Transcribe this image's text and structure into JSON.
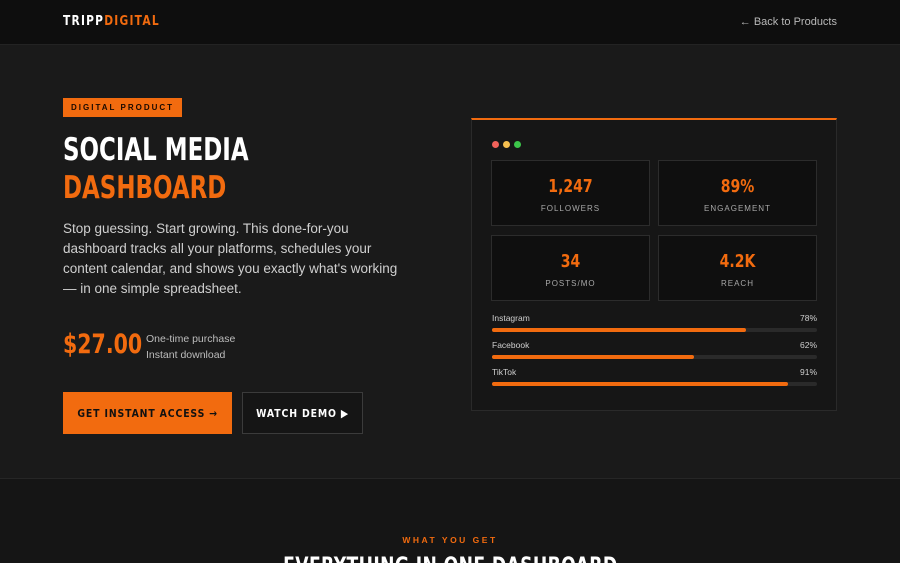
{
  "header": {
    "logo_part1": "TRIPP",
    "logo_part2": "DIGITAL",
    "back_link": "← Back to Products"
  },
  "hero": {
    "badge": "DIGITAL PRODUCT",
    "title_line1": "SOCIAL MEDIA",
    "title_line2": "DASHBOARD",
    "description": "Stop guessing. Start growing. This done-for-you dashboard tracks all your platforms, schedules your content calendar, and shows you exactly what's working — in one simple spreadsheet.",
    "price": "$27.00",
    "price_note1": "One-time purchase",
    "price_note2": "Instant download",
    "primary_button": "GET INSTANT ACCESS →",
    "secondary_button": "WATCH DEMO ▶"
  },
  "preview": {
    "window_dots": [
      "#f0625a",
      "#f5bf4f",
      "#3cc54a"
    ],
    "stats": [
      {
        "value": "1,247",
        "label": "FOLLOWERS"
      },
      {
        "value": "89%",
        "label": "ENGAGEMENT"
      },
      {
        "value": "34",
        "label": "POSTS/MO"
      },
      {
        "value": "4.2K",
        "label": "REACH"
      }
    ],
    "bars": [
      {
        "name": "Instagram",
        "percent_label": "78%",
        "fraction": 0.78
      },
      {
        "name": "Facebook",
        "percent_label": "62%",
        "fraction": 0.62
      },
      {
        "name": "TikTok",
        "percent_label": "91%",
        "fraction": 0.91
      }
    ]
  },
  "features": {
    "label": "WHAT YOU GET",
    "title": "EVERYTHING IN ONE DASHBOARD"
  },
  "colors": {
    "accent": "#f26b0f",
    "background": "#1a1a1a",
    "header_bg": "#0e0e0e"
  }
}
